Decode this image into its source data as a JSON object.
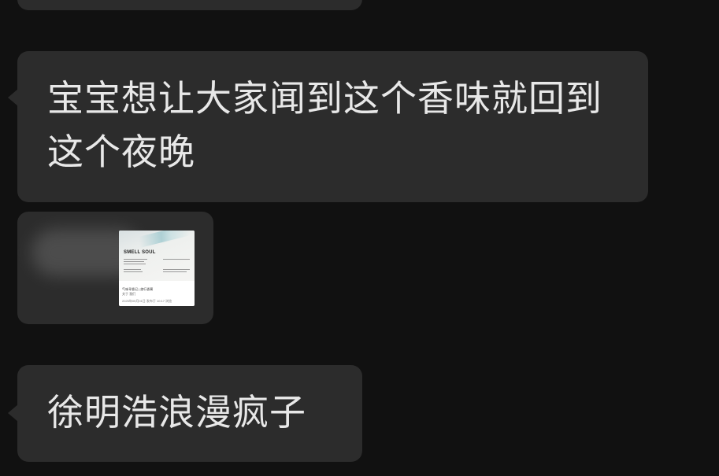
{
  "chat": {
    "messages": [
      {
        "type": "text",
        "text": "宝宝想让大家闻到这个香味就回到这个夜晚"
      },
      {
        "type": "card",
        "card_title": "SMELL SOUL",
        "card_caption": "气味寻香记 | 旅行香膏",
        "card_subcaption": "关于 我们",
        "card_meta": "2025年05月01日 发布于 10:17 浏览"
      },
      {
        "type": "text",
        "text": "徐明浩浪漫疯子"
      }
    ]
  },
  "colors": {
    "background": "#111111",
    "bubble": "#2c2c2c",
    "text": "#e8e8e8"
  }
}
